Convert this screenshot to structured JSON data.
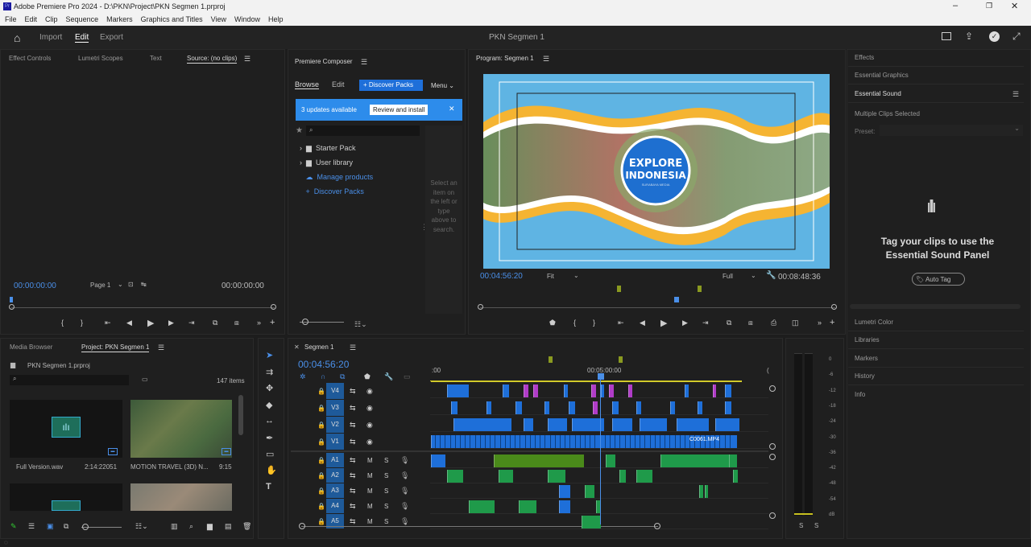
{
  "window": {
    "title": "Adobe Premiere Pro 2024 - D:\\PKN\\Project\\PKN Segmen 1.prproj"
  },
  "menu": [
    "File",
    "Edit",
    "Clip",
    "Sequence",
    "Markers",
    "Graphics and Titles",
    "View",
    "Window",
    "Help"
  ],
  "workspace": {
    "import": "Import",
    "edit": "Edit",
    "export": "Export",
    "center_title": "PKN Segmen 1"
  },
  "source_panel": {
    "tabs": [
      "Effect Controls",
      "Lumetri Scopes",
      "Text",
      "Source: (no clips)"
    ],
    "timecode_in": "00:00:00:00",
    "page": "Page 1",
    "timecode_out": "00:00:00:00"
  },
  "composer": {
    "title": "Premiere Composer",
    "tab_browse": "Browse",
    "tab_edit": "Edit",
    "discover_btn": "Discover Packs",
    "menu_btn": "Menu",
    "updates_text": "3 updates available",
    "review_btn": "Review and install",
    "items": [
      "Starter Pack",
      "User library",
      "Manage products",
      "Discover Packs"
    ],
    "select_hint": "Select an item on the left or type above to search."
  },
  "program": {
    "title": "Program: Segmen 1",
    "timecode": "00:04:56:20",
    "fit": "Fit",
    "quality": "Full",
    "duration": "00:08:48:36",
    "logo_line1": "EXPLORE",
    "logo_line2": "INDONESIA",
    "logo_sub": "SURABAYA MEDIA"
  },
  "right_panel": {
    "effects": "Effects",
    "essential_graphics": "Essential Graphics",
    "essential_sound": "Essential Sound",
    "multiple": "Multiple Clips Selected",
    "preset": "Preset:",
    "tag_title_1": "Tag your clips to use the",
    "tag_title_2": "Essential Sound Panel",
    "autotag": "Auto Tag",
    "sections": [
      "Lumetri Color",
      "Libraries",
      "Markers",
      "History",
      "Info"
    ]
  },
  "project": {
    "tab_media": "Media Browser",
    "tab_project": "Project: PKN Segmen 1",
    "filename": "PKN Segmen 1.prproj",
    "count": "147 items",
    "items": [
      {
        "name": "Full Version.wav",
        "duration": "2:14:22051"
      },
      {
        "name": "MOTION TRAVEL (3D) N...",
        "duration": "9:15"
      }
    ]
  },
  "timeline": {
    "seq_tab": "Segmen 1",
    "timecode": "00:04:56:20",
    "ruler_start": ":00",
    "ruler_mid": "00:05:00:00",
    "ruler_end": "(",
    "video_tracks": [
      "V4",
      "V3",
      "V2",
      "V1"
    ],
    "audio_tracks": [
      "A1",
      "A2",
      "A3",
      "A4",
      "A5"
    ],
    "clip_label": "C0061.MP4"
  },
  "meter": {
    "scale": [
      "0",
      "-6",
      "-12",
      "-18",
      "-24",
      "-30",
      "-36",
      "-42",
      "-48",
      "-54",
      "dB"
    ],
    "solo_left": "S",
    "solo_right": "S"
  },
  "colors": {
    "accent": "#2d8ceb",
    "video_clip": "#1e6fd9",
    "audio_clip": "#1f9a4a",
    "adjust_clip": "#b03cc8",
    "playhead": "#4a8fe8"
  }
}
